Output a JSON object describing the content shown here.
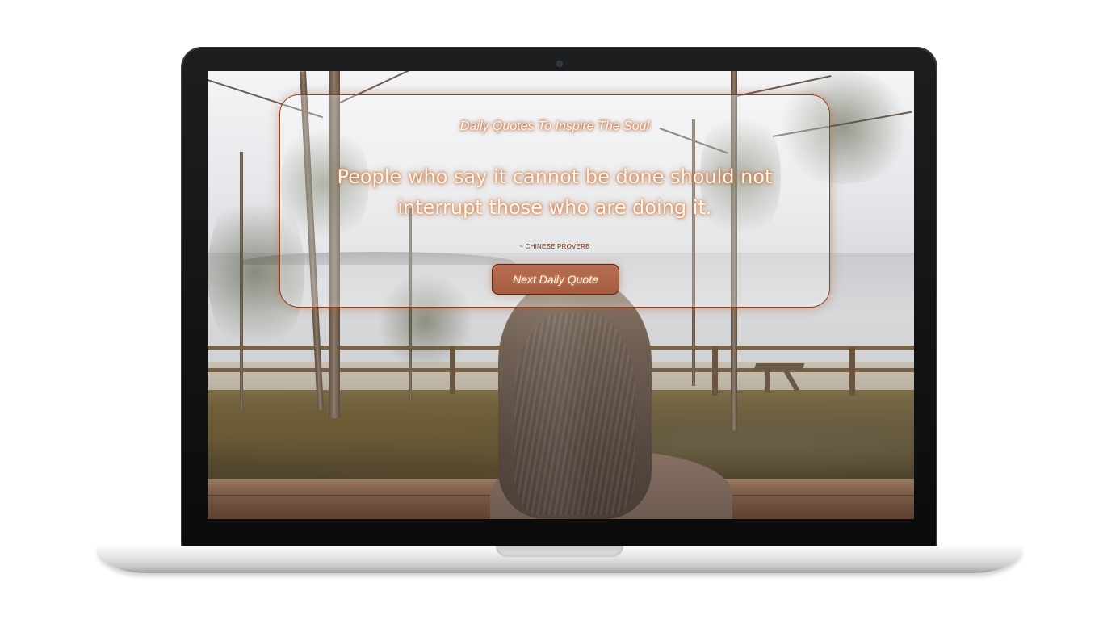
{
  "page": {
    "subtitle": "Daily Quotes To Inspire The Soul",
    "quote": "People who say it cannot be done should not interrupt those who are doing it.",
    "author": "~ CHINESE PROVERB",
    "next_button_label": "Next Daily Quote"
  },
  "colors": {
    "card_border": "#8a3f1f",
    "button_bg": "#a65b40",
    "text_glow": "#b8693a",
    "author_text": "#7a3517"
  },
  "icons": {
    "laptop_camera": "camera-icon"
  }
}
